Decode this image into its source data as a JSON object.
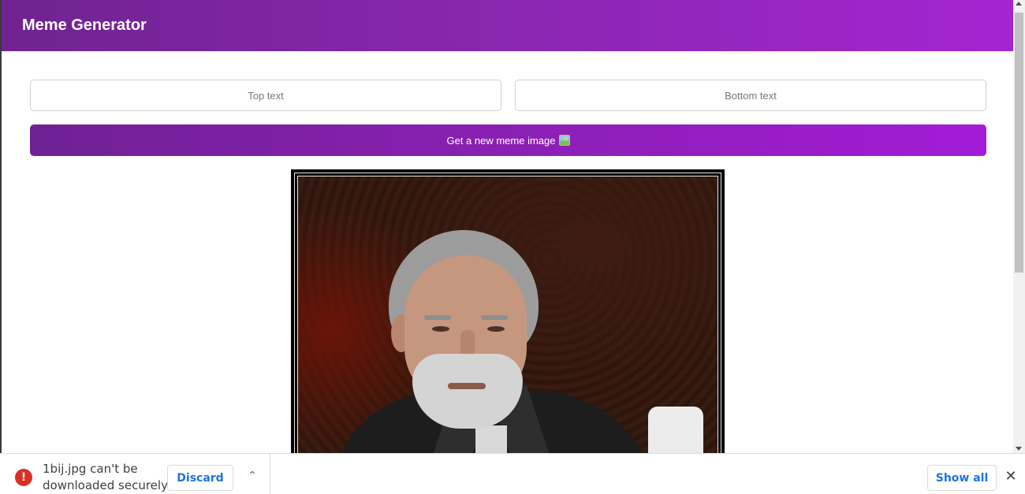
{
  "header": {
    "title": "Meme Generator"
  },
  "form": {
    "top_placeholder": "Top text",
    "bottom_placeholder": "Bottom text",
    "button_label": "Get a new meme image",
    "button_icon": "framed-picture-icon"
  },
  "meme": {
    "icon": "meme-image"
  },
  "download_bar": {
    "error_icon_glyph": "!",
    "message": "1bij.jpg can't be downloaded securely",
    "discard_label": "Discard",
    "chevron_glyph": "⌃",
    "show_all_label": "Show all",
    "close_glyph": "✕"
  }
}
